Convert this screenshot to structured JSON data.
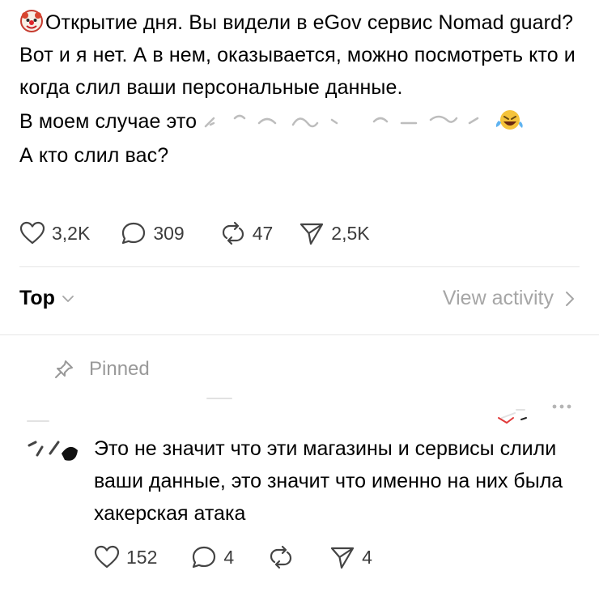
{
  "post": {
    "emoji": "clown-face",
    "line1": "Открытие дня. Вы видели в eGov сервис Nomad guard? Вот и я нет. А в нем, оказывается, можно посмотреть кто и когда слил ваши персональные данные.",
    "line2_prefix": "В моем случае это ",
    "end_emoji": "laughing-crying-face",
    "line3": "А кто слил вас?"
  },
  "post_actions": {
    "likes": "3,2K",
    "replies": "309",
    "reposts": "47",
    "shares": "2,5K"
  },
  "sort": {
    "label": "Top",
    "view_activity": "View activity"
  },
  "reply": {
    "pinned_label": "Pinned",
    "text": "Это не значит что эти магазины и сервисы слили ваши данные, это значит что именно на них была хакерская атака",
    "likes": "152",
    "replies": "4",
    "reposts": "",
    "shares": "4"
  },
  "colors": {
    "text": "#000000",
    "muted": "#999999",
    "action_icon": "#444444",
    "divider": "#e6e6e6"
  }
}
